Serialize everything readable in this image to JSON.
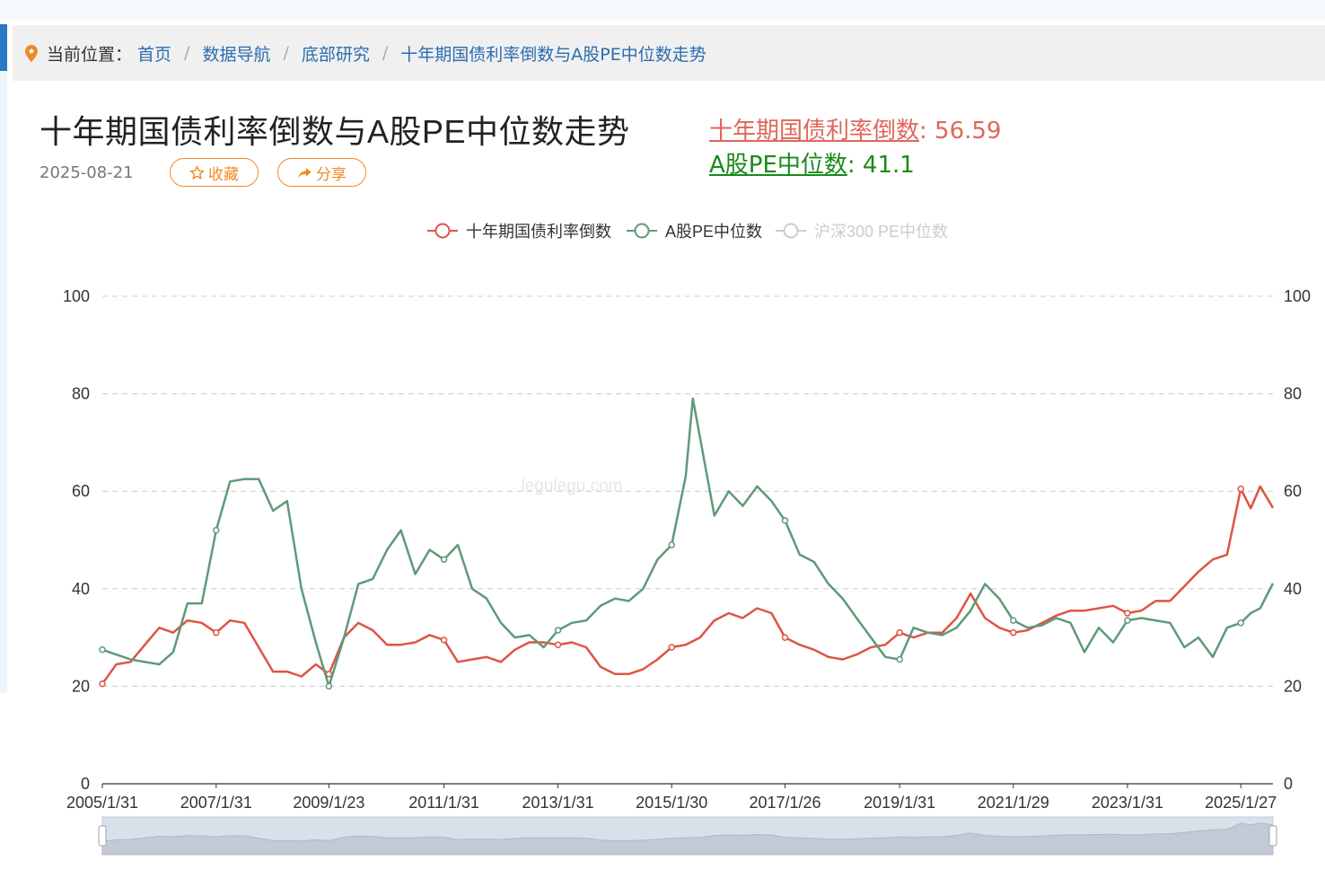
{
  "breadcrumb": {
    "label": "当前位置：",
    "items": [
      "首页",
      "数据导航",
      "底部研究",
      "十年期国债利率倒数与A股PE中位数走势"
    ]
  },
  "page": {
    "title": "十年期国债利率倒数与A股PE中位数走势",
    "date": "2025-08-21",
    "fav_label": "收藏",
    "share_label": "分享"
  },
  "stats": {
    "bond_name": "十年期国债利率倒数",
    "bond_value": ": 56.59",
    "pe_name": "A股PE中位数",
    "pe_value": ": 41.1"
  },
  "watermark": "legulegu.com",
  "colors": {
    "bond": "#dd5544",
    "pe": "#5f9a78",
    "hs300": "#cccccc",
    "accent": "#f08a24",
    "link": "#2b6cb0"
  },
  "icons": {
    "location": "map-pin-icon",
    "star": "star-icon",
    "share": "share-arrow-icon"
  },
  "chart_data": {
    "type": "line",
    "x_ticks": [
      "2005/1/31",
      "2007/1/31",
      "2009/1/23",
      "2011/1/31",
      "2013/1/31",
      "2015/1/30",
      "2017/1/26",
      "2019/1/31",
      "2021/1/29",
      "2023/1/31",
      "2025/1/27"
    ],
    "y_ticks": [
      0,
      20,
      40,
      60,
      80,
      100
    ],
    "ylim": [
      0,
      100
    ],
    "xlim": [
      "2005-01-31",
      "2025-08-21"
    ],
    "grid": true,
    "legend_position": "top-center",
    "dataZoom_slider": true,
    "series": [
      {
        "name": "十年期国债利率倒数",
        "color": "#dd5544",
        "points": [
          [
            "2005-01-31",
            20.5
          ],
          [
            "2005-04-30",
            24.5
          ],
          [
            "2005-07-31",
            25
          ],
          [
            "2005-10-31",
            28.5
          ],
          [
            "2006-01-31",
            32
          ],
          [
            "2006-04-30",
            31
          ],
          [
            "2006-07-31",
            33.5
          ],
          [
            "2006-10-31",
            33
          ],
          [
            "2007-01-31",
            31
          ],
          [
            "2007-04-30",
            33.5
          ],
          [
            "2007-07-31",
            33
          ],
          [
            "2007-10-31",
            28
          ],
          [
            "2008-01-31",
            23
          ],
          [
            "2008-04-30",
            23
          ],
          [
            "2008-07-31",
            22
          ],
          [
            "2008-10-31",
            24.5
          ],
          [
            "2009-01-23",
            22.5
          ],
          [
            "2009-04-30",
            30
          ],
          [
            "2009-07-31",
            33
          ],
          [
            "2009-10-31",
            31.5
          ],
          [
            "2010-01-31",
            28.5
          ],
          [
            "2010-04-30",
            28.5
          ],
          [
            "2010-07-31",
            29
          ],
          [
            "2010-10-31",
            30.5
          ],
          [
            "2011-01-31",
            29.5
          ],
          [
            "2011-04-30",
            25
          ],
          [
            "2011-07-31",
            25.5
          ],
          [
            "2011-10-31",
            26
          ],
          [
            "2012-01-31",
            25
          ],
          [
            "2012-04-30",
            27.5
          ],
          [
            "2012-07-31",
            29
          ],
          [
            "2012-10-31",
            29
          ],
          [
            "2013-01-31",
            28.5
          ],
          [
            "2013-04-30",
            29
          ],
          [
            "2013-07-31",
            28
          ],
          [
            "2013-10-31",
            24
          ],
          [
            "2014-01-31",
            22.5
          ],
          [
            "2014-04-30",
            22.5
          ],
          [
            "2014-07-31",
            23.5
          ],
          [
            "2014-10-31",
            25.5
          ],
          [
            "2015-01-30",
            28
          ],
          [
            "2015-04-30",
            28.5
          ],
          [
            "2015-07-31",
            30
          ],
          [
            "2015-10-31",
            33.5
          ],
          [
            "2016-01-31",
            35
          ],
          [
            "2016-04-30",
            34
          ],
          [
            "2016-07-31",
            36
          ],
          [
            "2016-10-31",
            35
          ],
          [
            "2017-01-26",
            30
          ],
          [
            "2017-04-30",
            28.5
          ],
          [
            "2017-07-31",
            27.5
          ],
          [
            "2017-10-31",
            26
          ],
          [
            "2018-01-31",
            25.5
          ],
          [
            "2018-04-30",
            26.5
          ],
          [
            "2018-07-31",
            28
          ],
          [
            "2018-10-31",
            28.5
          ],
          [
            "2019-01-31",
            31
          ],
          [
            "2019-04-30",
            30
          ],
          [
            "2019-07-31",
            31
          ],
          [
            "2019-10-31",
            31
          ],
          [
            "2020-01-31",
            34
          ],
          [
            "2020-04-30",
            39
          ],
          [
            "2020-07-31",
            34
          ],
          [
            "2020-10-31",
            32
          ],
          [
            "2021-01-29",
            31
          ],
          [
            "2021-04-30",
            31.5
          ],
          [
            "2021-07-31",
            33
          ],
          [
            "2021-10-31",
            34.5
          ],
          [
            "2022-01-31",
            35.5
          ],
          [
            "2022-04-30",
            35.5
          ],
          [
            "2022-07-31",
            36
          ],
          [
            "2022-10-31",
            36.5
          ],
          [
            "2023-01-31",
            35
          ],
          [
            "2023-04-30",
            35.5
          ],
          [
            "2023-07-31",
            37.5
          ],
          [
            "2023-10-31",
            37.5
          ],
          [
            "2024-01-31",
            40.5
          ],
          [
            "2024-04-30",
            43.5
          ],
          [
            "2024-07-31",
            46
          ],
          [
            "2024-10-31",
            47
          ],
          [
            "2025-01-27",
            60.5
          ],
          [
            "2025-03-31",
            56.5
          ],
          [
            "2025-05-31",
            61
          ],
          [
            "2025-08-21",
            56.59
          ]
        ]
      },
      {
        "name": "A股PE中位数",
        "color": "#5f9a78",
        "points": [
          [
            "2005-01-31",
            27.5
          ],
          [
            "2005-04-30",
            26.5
          ],
          [
            "2005-07-31",
            25.5
          ],
          [
            "2005-10-31",
            25
          ],
          [
            "2006-01-31",
            24.5
          ],
          [
            "2006-04-30",
            27
          ],
          [
            "2006-07-31",
            37
          ],
          [
            "2006-10-31",
            37
          ],
          [
            "2007-01-31",
            52
          ],
          [
            "2007-04-30",
            62
          ],
          [
            "2007-07-31",
            62.5
          ],
          [
            "2007-10-31",
            62.5
          ],
          [
            "2008-01-31",
            56
          ],
          [
            "2008-04-30",
            58
          ],
          [
            "2008-07-31",
            40
          ],
          [
            "2008-10-31",
            29
          ],
          [
            "2009-01-23",
            20
          ],
          [
            "2009-04-30",
            30
          ],
          [
            "2009-07-31",
            41
          ],
          [
            "2009-10-31",
            42
          ],
          [
            "2010-01-31",
            48
          ],
          [
            "2010-04-30",
            52
          ],
          [
            "2010-07-31",
            43
          ],
          [
            "2010-10-31",
            48
          ],
          [
            "2011-01-31",
            46
          ],
          [
            "2011-04-30",
            49
          ],
          [
            "2011-07-31",
            40
          ],
          [
            "2011-10-31",
            38
          ],
          [
            "2012-01-31",
            33
          ],
          [
            "2012-04-30",
            30
          ],
          [
            "2012-07-31",
            30.5
          ],
          [
            "2012-10-31",
            28
          ],
          [
            "2013-01-31",
            31.5
          ],
          [
            "2013-04-30",
            33
          ],
          [
            "2013-07-31",
            33.5
          ],
          [
            "2013-10-31",
            36.5
          ],
          [
            "2014-01-31",
            38
          ],
          [
            "2014-04-30",
            37.5
          ],
          [
            "2014-07-31",
            40
          ],
          [
            "2014-10-31",
            46
          ],
          [
            "2015-01-30",
            49
          ],
          [
            "2015-04-30",
            63
          ],
          [
            "2015-06-15",
            79
          ],
          [
            "2015-10-31",
            55
          ],
          [
            "2016-01-31",
            60
          ],
          [
            "2016-04-30",
            57
          ],
          [
            "2016-07-31",
            61
          ],
          [
            "2016-10-31",
            58
          ],
          [
            "2017-01-26",
            54
          ],
          [
            "2017-04-30",
            47
          ],
          [
            "2017-07-31",
            45.5
          ],
          [
            "2017-10-31",
            41
          ],
          [
            "2018-01-31",
            38
          ],
          [
            "2018-04-30",
            34
          ],
          [
            "2018-07-31",
            30
          ],
          [
            "2018-10-31",
            26
          ],
          [
            "2019-01-31",
            25.5
          ],
          [
            "2019-04-30",
            32
          ],
          [
            "2019-07-31",
            31
          ],
          [
            "2019-10-31",
            30.5
          ],
          [
            "2020-01-31",
            32
          ],
          [
            "2020-04-30",
            35.5
          ],
          [
            "2020-07-31",
            41
          ],
          [
            "2020-10-31",
            38
          ],
          [
            "2021-01-29",
            33.5
          ],
          [
            "2021-04-30",
            32
          ],
          [
            "2021-07-31",
            32.5
          ],
          [
            "2021-10-31",
            34
          ],
          [
            "2022-01-31",
            33
          ],
          [
            "2022-04-30",
            27
          ],
          [
            "2022-07-31",
            32
          ],
          [
            "2022-10-31",
            29
          ],
          [
            "2023-01-31",
            33.5
          ],
          [
            "2023-04-30",
            34
          ],
          [
            "2023-07-31",
            33.5
          ],
          [
            "2023-10-31",
            33
          ],
          [
            "2024-01-31",
            28
          ],
          [
            "2024-04-30",
            30
          ],
          [
            "2024-07-31",
            26
          ],
          [
            "2024-10-31",
            32
          ],
          [
            "2025-01-27",
            33
          ],
          [
            "2025-03-31",
            35
          ],
          [
            "2025-05-31",
            36
          ],
          [
            "2025-08-21",
            41.1
          ]
        ]
      },
      {
        "name": "沪深300 PE中位数",
        "color": "#cccccc",
        "hidden": true,
        "points": []
      }
    ]
  }
}
